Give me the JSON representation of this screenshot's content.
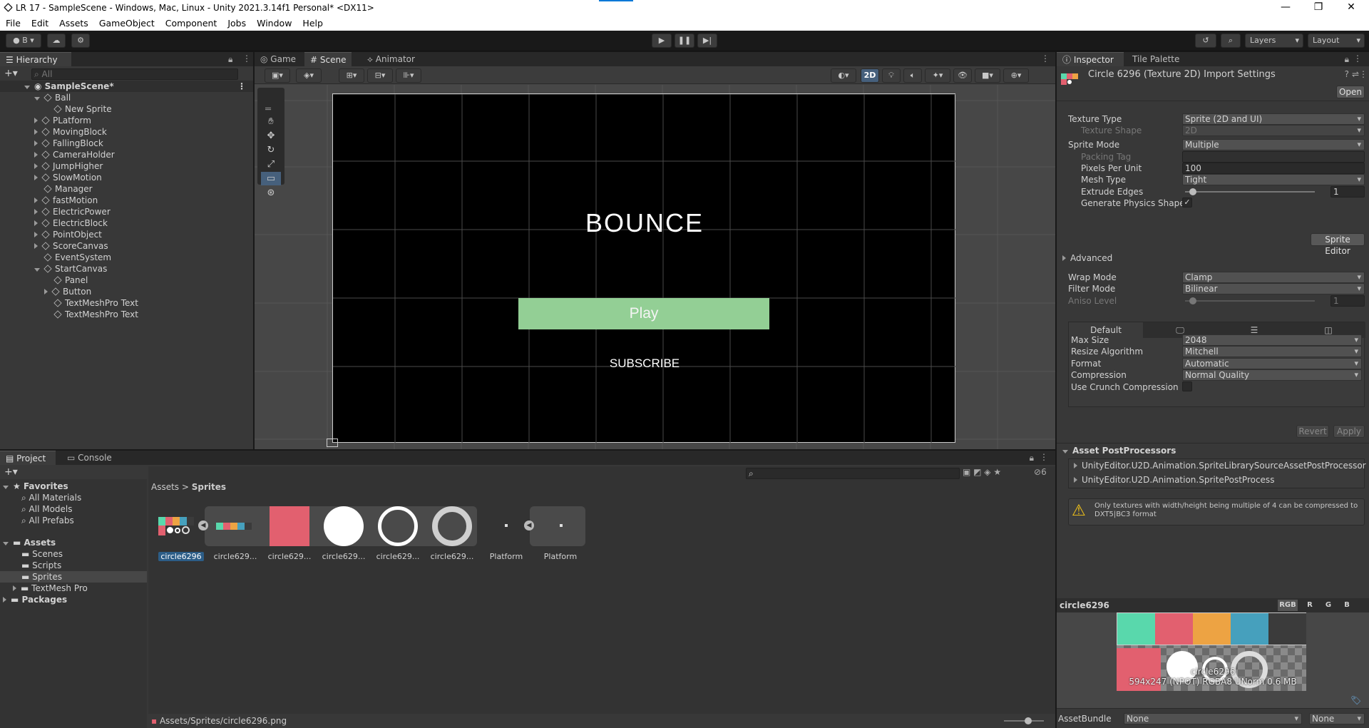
{
  "window": {
    "title": "LR 17 - SampleScene - Windows, Mac, Linux - Unity 2021.3.14f1 Personal* <DX11>"
  },
  "menu": [
    "File",
    "Edit",
    "Assets",
    "GameObject",
    "Component",
    "Jobs",
    "Window",
    "Help"
  ],
  "toolbar": {
    "account": "B",
    "layers": "Layers",
    "layout": "Layout"
  },
  "hierarchy": {
    "tab": "Hierarchy",
    "search_placeholder": "All",
    "scene": "SampleScene*",
    "items": [
      {
        "label": "Ball",
        "depth": 1,
        "expand": "open"
      },
      {
        "label": "New Sprite",
        "depth": 2,
        "expand": "none"
      },
      {
        "label": "PLatform",
        "depth": 1,
        "expand": "closed"
      },
      {
        "label": "MovingBlock",
        "depth": 1,
        "expand": "closed"
      },
      {
        "label": "FallingBlock",
        "depth": 1,
        "expand": "closed"
      },
      {
        "label": "CameraHolder",
        "depth": 1,
        "expand": "closed"
      },
      {
        "label": "JumpHigher",
        "depth": 1,
        "expand": "closed"
      },
      {
        "label": "SlowMotion",
        "depth": 1,
        "expand": "closed"
      },
      {
        "label": "Manager",
        "depth": 1,
        "expand": "none"
      },
      {
        "label": "fastMotion",
        "depth": 1,
        "expand": "closed"
      },
      {
        "label": "ElectricPower",
        "depth": 1,
        "expand": "closed"
      },
      {
        "label": "ElectricBlock",
        "depth": 1,
        "expand": "closed"
      },
      {
        "label": "PointObject",
        "depth": 1,
        "expand": "closed"
      },
      {
        "label": "ScoreCanvas",
        "depth": 1,
        "expand": "closed"
      },
      {
        "label": "EventSystem",
        "depth": 1,
        "expand": "none"
      },
      {
        "label": "StartCanvas",
        "depth": 1,
        "expand": "open"
      },
      {
        "label": "Panel",
        "depth": 2,
        "expand": "none"
      },
      {
        "label": "Button",
        "depth": 2,
        "expand": "closed"
      },
      {
        "label": "TextMeshPro Text",
        "depth": 2,
        "expand": "none"
      },
      {
        "label": "TextMeshPro Text",
        "depth": 2,
        "expand": "none"
      }
    ]
  },
  "scene_tabs": [
    "Game",
    "Scene",
    "Animator"
  ],
  "scene_toggle_2d": "2D",
  "scene": {
    "title": "BOUNCE",
    "play": "Play",
    "subscribe": "SUBSCRIBE",
    "colors": {
      "button": "#93cf95"
    }
  },
  "inspector": {
    "tabs": [
      "Inspector",
      "Tile Palette"
    ],
    "title": "Circle 6296 (Texture 2D) Import Settings",
    "open": "Open",
    "props": [
      {
        "label": "Texture Type",
        "value": "Sprite (2D and UI)",
        "kind": "dd"
      },
      {
        "label": "Texture Shape",
        "value": "2D",
        "kind": "dd",
        "dim": true
      },
      {
        "label": "Sprite Mode",
        "value": "Multiple",
        "kind": "dd"
      },
      {
        "label": "Packing Tag",
        "value": "",
        "kind": "text",
        "dim": true
      },
      {
        "label": "Pixels Per Unit",
        "value": "100",
        "kind": "text"
      },
      {
        "label": "Mesh Type",
        "value": "Tight",
        "kind": "dd"
      },
      {
        "label": "Extrude Edges",
        "value": "1",
        "kind": "slider",
        "level": 0.06
      },
      {
        "label": "Generate Physics Shape",
        "value": "✓",
        "kind": "check"
      }
    ],
    "sprite_editor": "Sprite Editor",
    "advanced": "Advanced",
    "props2": [
      {
        "label": "Wrap Mode",
        "value": "Clamp",
        "kind": "dd"
      },
      {
        "label": "Filter Mode",
        "value": "Bilinear",
        "kind": "dd"
      },
      {
        "label": "Aniso Level",
        "value": "1",
        "kind": "slider",
        "dim": true,
        "level": 0.06
      }
    ],
    "platform_tab": "Default",
    "platform": [
      {
        "label": "Max Size",
        "value": "2048"
      },
      {
        "label": "Resize Algorithm",
        "value": "Mitchell"
      },
      {
        "label": "Format",
        "value": "Automatic"
      },
      {
        "label": "Compression",
        "value": "Normal Quality"
      },
      {
        "label": "Use Crunch Compression",
        "value": ""
      }
    ],
    "revert": "Revert",
    "apply": "Apply",
    "postproc_title": "Asset PostProcessors",
    "postproc": [
      "UnityEditor.U2D.Animation.SpriteLibrarySourceAssetPostProcessor",
      "UnityEditor.U2D.Animation.SpritePostProcess"
    ],
    "warning": "Only textures with width/height being multiple of 4 can be compressed to DXT5|BC3 format",
    "preview": {
      "name": "circle6296",
      "channels": [
        "RGB",
        "R",
        "G",
        "B"
      ],
      "overlay_name": "circle6296",
      "info": "594x247 (NPOT)  RGBA8 UNorm  0.6 MB",
      "palette": [
        "#59d8ac",
        "#e2606f",
        "#eda343",
        "#46a0bd",
        "#3b3b3b"
      ]
    },
    "assetbundle": {
      "label": "AssetBundle",
      "value": "None",
      "variant": "None"
    }
  },
  "project": {
    "tabs": [
      "Project",
      "Console"
    ],
    "favorites": "Favorites",
    "fav_items": [
      "All Materials",
      "All Models",
      "All Prefabs"
    ],
    "assets": "Assets",
    "asset_folders": [
      "Scenes",
      "Scripts",
      "Sprites",
      "TextMesh Pro"
    ],
    "packages": "Packages",
    "breadcrumb": [
      "Assets",
      "Sprites"
    ],
    "hidden_count": "6",
    "thumbs": [
      "circle6296",
      "circle629...",
      "circle629...",
      "circle629...",
      "circle629...",
      "circle629...",
      "Platform",
      "Platform"
    ],
    "path": "Assets/Sprites/circle6296.png"
  }
}
